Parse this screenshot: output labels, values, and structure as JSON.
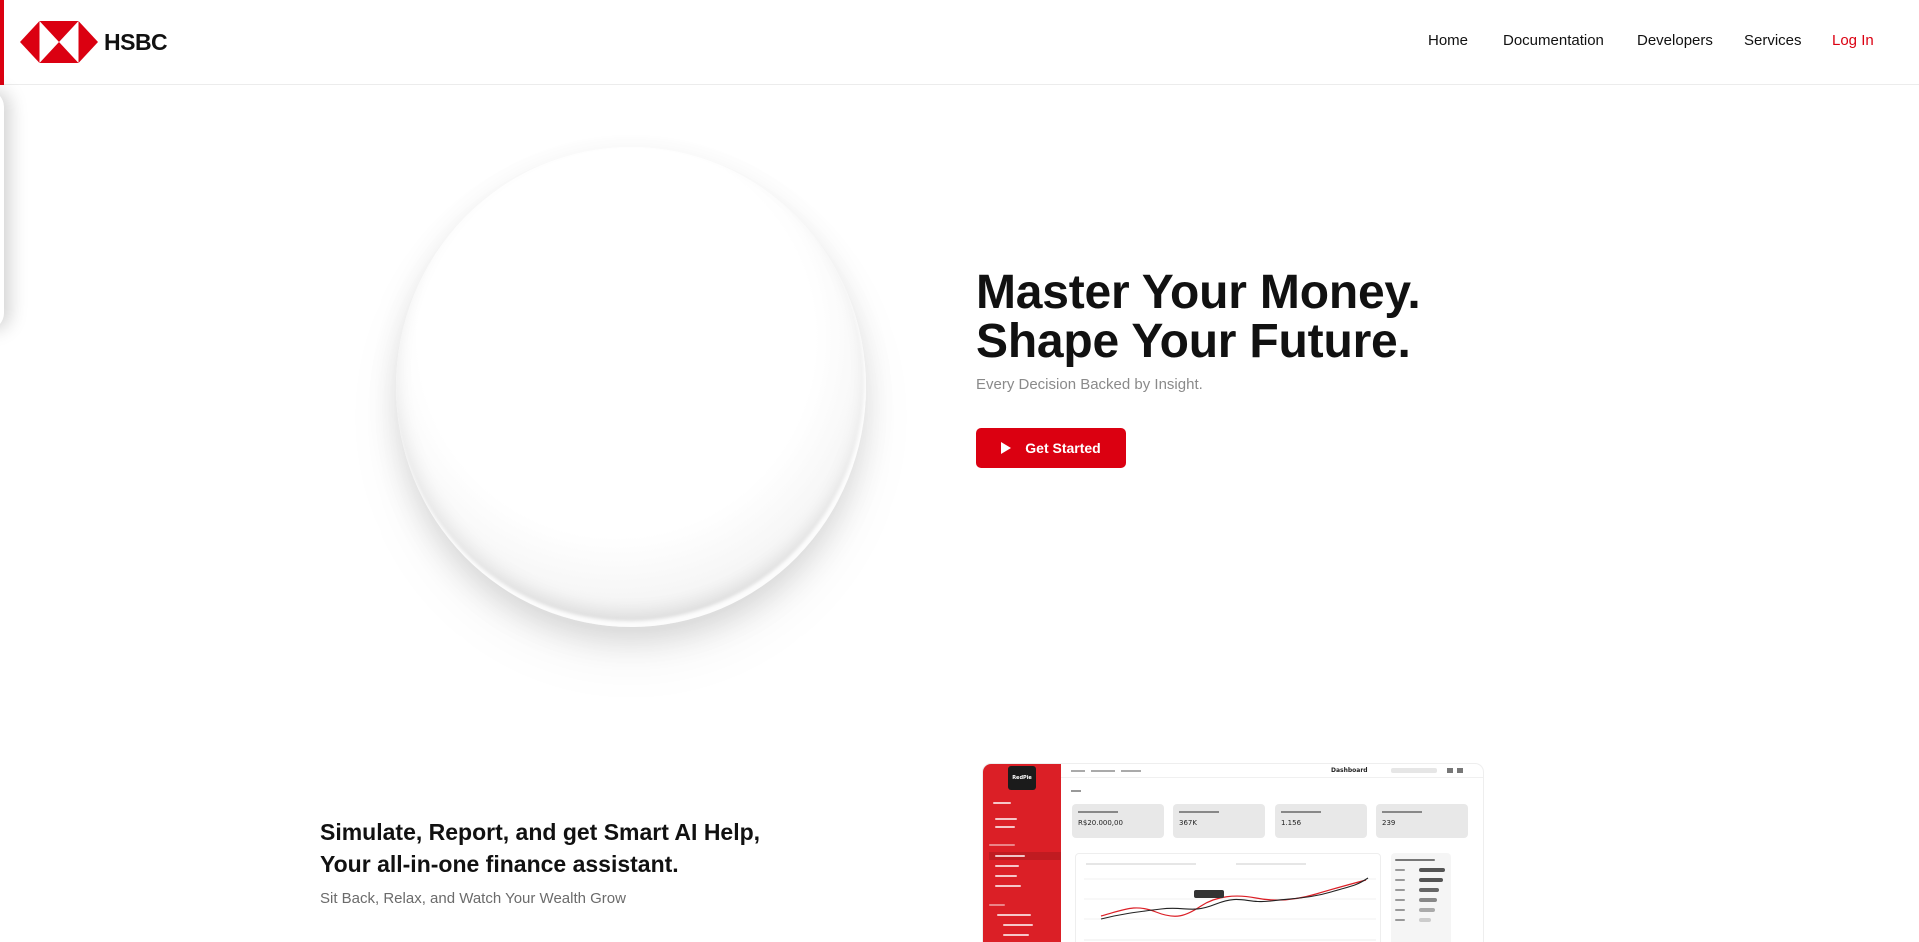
{
  "brand": {
    "name": "HSBC",
    "color": "#db0011"
  },
  "nav": {
    "items": [
      {
        "label": "Home"
      },
      {
        "label": "Documentation"
      },
      {
        "label": "Developers"
      },
      {
        "label": "Services"
      },
      {
        "label": "Log In"
      }
    ]
  },
  "hero": {
    "title_line1": "Master Your Money.",
    "title_line2": "Shape Your Future.",
    "subtitle": "Every Decision Backed by Insight.",
    "cta_label": "Get Started",
    "cta_icon": "play-icon"
  },
  "feature": {
    "title_line1": "Simulate, Report, and get Smart AI Help,",
    "title_line2": "Your all-in-one finance assistant.",
    "subtitle": "Sit Back, Relax, and Watch Your Wealth Grow"
  },
  "dashboard_preview": {
    "title": "Dashboard",
    "logo": "RedPie",
    "cards": [
      {
        "value": "R$20.000,00"
      },
      {
        "value": "367K"
      },
      {
        "value": "1.156"
      },
      {
        "value": "239"
      }
    ]
  }
}
